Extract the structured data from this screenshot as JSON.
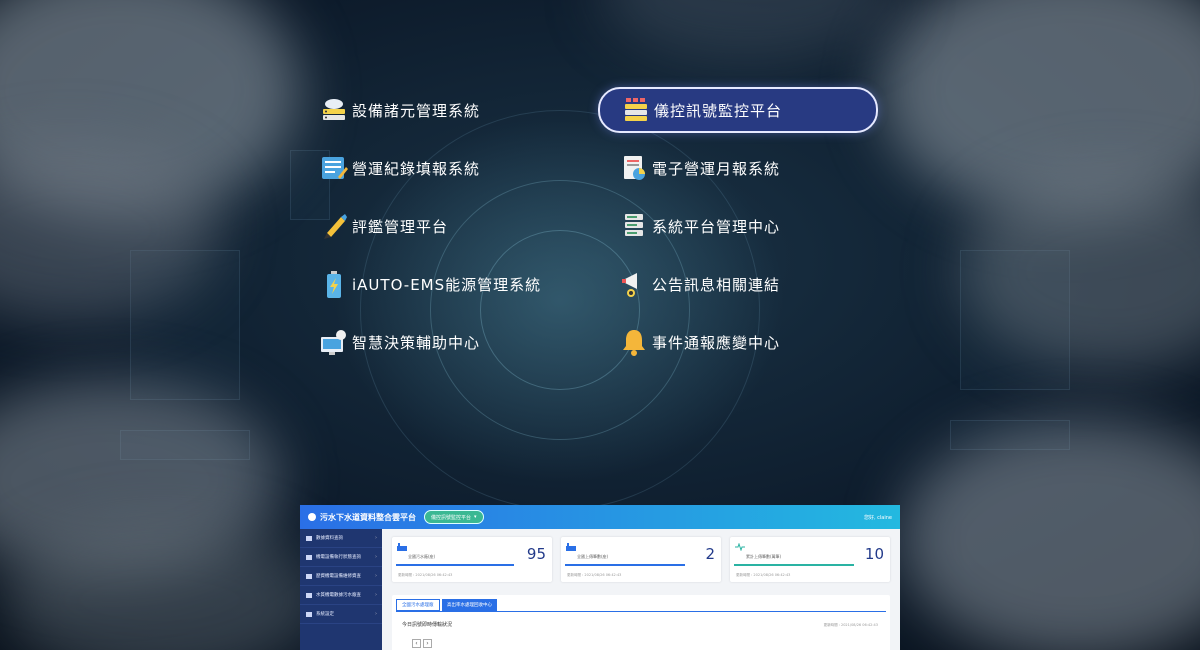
{
  "menu": {
    "items": [
      {
        "label": "設備諸元管理系統",
        "icon": "cloud-server-icon"
      },
      {
        "label": "儀控訊號監控平台",
        "icon": "server-stack-icon",
        "active": true
      },
      {
        "label": "營運紀錄填報系統",
        "icon": "form-edit-icon"
      },
      {
        "label": "電子營運月報系統",
        "icon": "report-chart-icon"
      },
      {
        "label": "評鑑管理平台",
        "icon": "pen-icon"
      },
      {
        "label": "系統平台管理中心",
        "icon": "server-rack-icon"
      },
      {
        "label": "iAUTO-EMS能源管理系統",
        "icon": "battery-icon"
      },
      {
        "label": "公告訊息相關連結",
        "icon": "megaphone-icon"
      },
      {
        "label": "智慧決策輔助中心",
        "icon": "dashboard-monitor-icon"
      },
      {
        "label": "事件通報應變中心",
        "icon": "bell-icon"
      }
    ]
  },
  "dashboard": {
    "title": "污水下水道資料整合雲平台",
    "platform_pill": "儀控訊號監控平台",
    "user": "您好, claine",
    "sidebar": [
      "數據資料查詢",
      "機電設備執行狀態查詢",
      "歷資機電設備維修資查",
      "水質機電數據污水廠查",
      "系統設定"
    ],
    "cards": [
      {
        "label": "全國污水廠(座)",
        "value": "95",
        "time": "更新時間 : 2021/08/26 06:42:43"
      },
      {
        "label": "全國上傳筆數(座)",
        "value": "2",
        "time": "更新時間 : 2021/08/26 06:42:43"
      },
      {
        "label": "累計上傳筆數(萬筆)",
        "value": "10",
        "time": "更新時間 : 2021/08/26 06:42:43"
      }
    ],
    "tabs": [
      "全國污水處理廠",
      "高出率水處理回收中心"
    ],
    "panel_title": "今日訊號即時傳輸狀況",
    "panel_time": "更新時間 : 2021/08/26 06:42:43"
  }
}
